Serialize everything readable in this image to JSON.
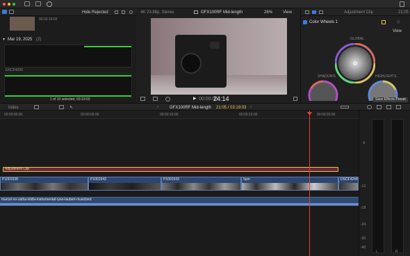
{
  "toolbar": {
    "icons": [
      "library-icon",
      "import-icon",
      "keyword-icon",
      "check-icon",
      "share-icon"
    ]
  },
  "browser": {
    "filter": "Hide Rejected",
    "top_clip_duration": "00:03:19:03",
    "date_header": "Mar 19, 2025",
    "date_count": "(2)",
    "clip_name": "DSCF4290",
    "status": "1 of 10 selected, 03:19:03"
  },
  "viewer": {
    "format": "4K 23.98p, Stereo",
    "project": "GFX100RF Mid-length",
    "zoom": "26%",
    "view_label": "View",
    "timecode": "24:14",
    "timecode_prefix": "00:00:00"
  },
  "inspector": {
    "title": "Adjustment Clip",
    "duration": "21:05",
    "effect_name": "Color Wheels 1",
    "view_label": "View",
    "wheel_global": "GLOBAL",
    "wheel_shadows": "SHADOWS",
    "wheel_highlights": "HIGHLIGHTS",
    "save_preset": "Save Effects Preset"
  },
  "timeline_bar": {
    "index": "Index",
    "project": "GFX100RF Mid-length",
    "time": "21:05 / 03:19:03"
  },
  "ruler": [
    "00:00:00:00",
    "00:00:05:00",
    "00:00:10:00",
    "00:00:15:00",
    "00:00:20:00",
    "00:00:25:00"
  ],
  "adjustment_clip": "Adjustment Clip",
  "clips": [
    "P1001538",
    "P1001543",
    "P1001543",
    "5pm",
    "DSCF4244"
  ],
  "audio_clip": "marcel-no-zatha-shilla-instrumental-ryan-laubert-musicbed",
  "meters": {
    "scale": [
      "-6",
      "-12",
      "-18",
      "-24",
      "-30",
      "-40",
      "-50"
    ],
    "left_label": "L",
    "right_label": "R"
  },
  "colors": {
    "accent": "#f2c14e",
    "clip_blue": "#2d4670",
    "audio": "#2f4a73",
    "playhead": "#e34234",
    "level": "#3ad13a"
  }
}
